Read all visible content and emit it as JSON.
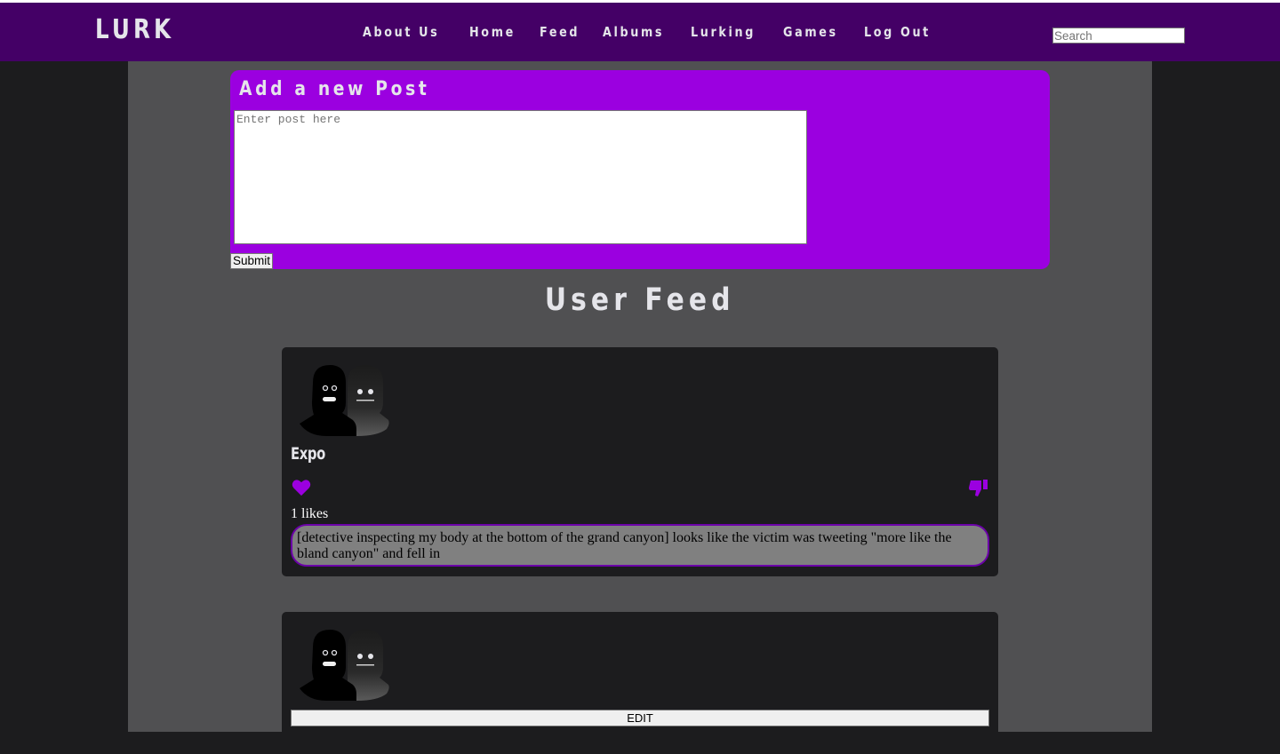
{
  "nav": {
    "brand": "LURK",
    "links": [
      "About Us",
      "Home",
      "Feed",
      "Albums",
      "Lurking",
      "Games",
      "Log Out"
    ],
    "search_placeholder": "Search"
  },
  "add_post": {
    "title": "Add a new Post",
    "input_placeholder": "Enter post here",
    "input_value": "",
    "submit_label": "Submit"
  },
  "feed": {
    "title": "User Feed",
    "posts": [
      {
        "avatar_icon": "two-silhouettes-avatar-icon",
        "username": "Expo",
        "like_icon": "heart-icon",
        "dislike_icon": "thumbs-down-icon",
        "likes_text": "1 likes",
        "body": "[detective inspecting my body at the bottom of the grand canyon] looks like the victim was tweeting \"more like the bland canyon\" and fell in"
      },
      {
        "avatar_icon": "two-silhouettes-avatar-icon",
        "edit_label": "EDIT"
      }
    ]
  },
  "colors": {
    "navbar": "#440066",
    "accent": "#9b00e0",
    "page_bg": "#1c1c1e",
    "content_bg": "#505052",
    "card_bg": "#1c1c1e",
    "post_border": "#6b00a8",
    "post_bg": "#808080",
    "text_light": "#e5e5ea"
  }
}
